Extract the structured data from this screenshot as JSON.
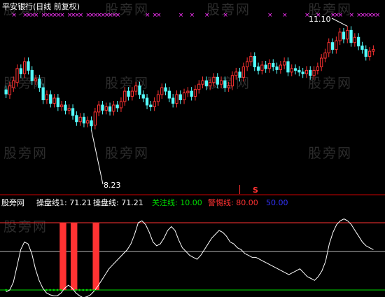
{
  "colors": {
    "background": "#000000",
    "up": "#ff3232",
    "down": "#54ffff",
    "marker": "#ff33ff",
    "divider": "#cc0000",
    "indicator": "#ffffff",
    "focus": "#00dd00",
    "alert": "#ff3232",
    "fifty": "#3333ff",
    "text_white": "#ffffff",
    "text_gray": "#c8c8c8",
    "signal_s": "#ff3232"
  },
  "chart_data": [
    {
      "type": "candlestick",
      "title": "平安银行(日线 前复权)",
      "y_range": [
        6.6,
        11.4
      ],
      "annotations": [
        {
          "text": "11.10",
          "kind": "high",
          "x_index": 92
        },
        {
          "text": "8.23",
          "kind": "low",
          "x_index": 23
        }
      ],
      "signal": {
        "text": "S",
        "x_index": 63
      },
      "markers_x": [
        2,
        5,
        6,
        7,
        8,
        10,
        11,
        12,
        13,
        14,
        15,
        17,
        18,
        19,
        20,
        22,
        23,
        24,
        25,
        26,
        27,
        28,
        29,
        30,
        38,
        40,
        41,
        47,
        50,
        54,
        59,
        71,
        75,
        81,
        84,
        88,
        89,
        90,
        93,
        95,
        96,
        97,
        98,
        99,
        100
      ],
      "candles": [
        {
          "o": 9.34,
          "c": 9.22
        },
        {
          "o": 9.2,
          "c": 9.45
        },
        {
          "o": 9.4,
          "c": 9.6
        },
        {
          "o": 9.55,
          "c": 9.95
        },
        {
          "o": 9.95,
          "c": 9.8
        },
        {
          "o": 9.8,
          "c": 10.15
        },
        {
          "o": 10.15,
          "c": 9.9
        },
        {
          "o": 9.9,
          "c": 9.6
        },
        {
          "o": 9.6,
          "c": 9.65
        },
        {
          "o": 9.65,
          "c": 9.4
        },
        {
          "o": 9.4,
          "c": 9.05
        },
        {
          "o": 9.05,
          "c": 9.2
        },
        {
          "o": 9.2,
          "c": 8.95
        },
        {
          "o": 8.95,
          "c": 9.1
        },
        {
          "o": 9.1,
          "c": 8.85
        },
        {
          "o": 8.85,
          "c": 8.9
        },
        {
          "o": 8.9,
          "c": 8.75
        },
        {
          "o": 8.75,
          "c": 8.8
        },
        {
          "o": 8.8,
          "c": 8.6
        },
        {
          "o": 8.6,
          "c": 8.42
        },
        {
          "o": 8.42,
          "c": 8.55
        },
        {
          "o": 8.55,
          "c": 8.38
        },
        {
          "o": 8.38,
          "c": 8.45
        },
        {
          "o": 8.45,
          "c": 8.3
        },
        {
          "o": 8.32,
          "c": 8.7
        },
        {
          "o": 8.7,
          "c": 8.9
        },
        {
          "o": 8.9,
          "c": 8.75
        },
        {
          "o": 8.75,
          "c": 8.85
        },
        {
          "o": 8.85,
          "c": 8.72
        },
        {
          "o": 8.72,
          "c": 8.9
        },
        {
          "o": 8.9,
          "c": 8.82
        },
        {
          "o": 8.82,
          "c": 9.0
        },
        {
          "o": 9.0,
          "c": 9.3
        },
        {
          "o": 9.3,
          "c": 9.15
        },
        {
          "o": 9.15,
          "c": 9.3
        },
        {
          "o": 9.3,
          "c": 9.45
        },
        {
          "o": 9.45,
          "c": 9.2
        },
        {
          "o": 9.2,
          "c": 9.1
        },
        {
          "o": 9.1,
          "c": 8.9
        },
        {
          "o": 8.9,
          "c": 8.85
        },
        {
          "o": 8.85,
          "c": 9.0
        },
        {
          "o": 9.0,
          "c": 9.2
        },
        {
          "o": 9.2,
          "c": 9.4
        },
        {
          "o": 9.4,
          "c": 9.3
        },
        {
          "o": 9.3,
          "c": 9.1
        },
        {
          "o": 9.1,
          "c": 8.95
        },
        {
          "o": 8.95,
          "c": 9.2
        },
        {
          "o": 9.2,
          "c": 9.05
        },
        {
          "o": 9.05,
          "c": 9.25
        },
        {
          "o": 9.25,
          "c": 9.3
        },
        {
          "o": 9.3,
          "c": 9.15
        },
        {
          "o": 9.15,
          "c": 9.35
        },
        {
          "o": 9.35,
          "c": 9.5
        },
        {
          "o": 9.5,
          "c": 9.6
        },
        {
          "o": 9.6,
          "c": 9.45
        },
        {
          "o": 9.45,
          "c": 9.55
        },
        {
          "o": 9.55,
          "c": 9.7
        },
        {
          "o": 9.7,
          "c": 9.5
        },
        {
          "o": 9.5,
          "c": 9.6
        },
        {
          "o": 9.6,
          "c": 9.4
        },
        {
          "o": 9.4,
          "c": 9.45
        },
        {
          "o": 9.45,
          "c": 9.75
        },
        {
          "o": 9.75,
          "c": 9.85
        },
        {
          "o": 9.85,
          "c": 9.7
        },
        {
          "o": 9.7,
          "c": 10.0
        },
        {
          "o": 10.0,
          "c": 10.15
        },
        {
          "o": 10.15,
          "c": 10.3
        },
        {
          "o": 10.3,
          "c": 10.0
        },
        {
          "o": 10.0,
          "c": 9.9
        },
        {
          "o": 9.9,
          "c": 10.05
        },
        {
          "o": 10.05,
          "c": 9.95
        },
        {
          "o": 9.95,
          "c": 10.1
        },
        {
          "o": 10.1,
          "c": 10.0
        },
        {
          "o": 10.0,
          "c": 9.92
        },
        {
          "o": 9.92,
          "c": 10.05
        },
        {
          "o": 10.05,
          "c": 10.15
        },
        {
          "o": 10.15,
          "c": 9.85
        },
        {
          "o": 9.85,
          "c": 9.95
        },
        {
          "o": 9.95,
          "c": 9.9
        },
        {
          "o": 9.9,
          "c": 9.85
        },
        {
          "o": 9.85,
          "c": 9.8
        },
        {
          "o": 9.8,
          "c": 9.9
        },
        {
          "o": 9.9,
          "c": 9.75
        },
        {
          "o": 9.75,
          "c": 9.9
        },
        {
          "o": 9.9,
          "c": 10.0
        },
        {
          "o": 10.0,
          "c": 10.25
        },
        {
          "o": 10.25,
          "c": 10.4
        },
        {
          "o": 10.4,
          "c": 10.7
        },
        {
          "o": 10.7,
          "c": 10.5
        },
        {
          "o": 10.5,
          "c": 10.75
        },
        {
          "o": 10.75,
          "c": 11.0
        },
        {
          "o": 11.0,
          "c": 10.8
        },
        {
          "o": 10.8,
          "c": 11.05
        },
        {
          "o": 11.05,
          "c": 10.7
        },
        {
          "o": 10.7,
          "c": 10.85
        },
        {
          "o": 10.85,
          "c": 10.6
        },
        {
          "o": 10.6,
          "c": 10.5
        },
        {
          "o": 10.5,
          "c": 10.3
        },
        {
          "o": 10.3,
          "c": 10.45
        },
        {
          "o": 10.45,
          "c": 10.5
        }
      ]
    },
    {
      "type": "line",
      "name": "操盘线1",
      "value_label": "71.21",
      "y_range": [
        0,
        100
      ],
      "reference_lines": [
        {
          "name": "关注线",
          "value": 10,
          "value_label": "10.00"
        },
        {
          "name": "警惕线",
          "value": 80,
          "value_label": "80.00"
        },
        {
          "name": "fifty",
          "value": 50,
          "value_label": "50.00"
        }
      ],
      "values": [
        8,
        10,
        18,
        35,
        52,
        60,
        58,
        48,
        32,
        20,
        12,
        7,
        5,
        4,
        4,
        7,
        12,
        15,
        12,
        7,
        4,
        2,
        3,
        5,
        9,
        14,
        20,
        26,
        32,
        36,
        40,
        44,
        48,
        52,
        58,
        68,
        80,
        82,
        78,
        70,
        60,
        56,
        58,
        64,
        72,
        76,
        72,
        62,
        54,
        50,
        46,
        44,
        42,
        46,
        52,
        58,
        64,
        68,
        72,
        70,
        66,
        60,
        58,
        54,
        52,
        48,
        46,
        44,
        44,
        42,
        40,
        38,
        36,
        34,
        32,
        30,
        28,
        26,
        28,
        30,
        32,
        28,
        24,
        22,
        20,
        24,
        30,
        40,
        58,
        70,
        78,
        82,
        84,
        82,
        78,
        72,
        66,
        60,
        56,
        54,
        52
      ],
      "signal_bars": [
        {
          "start": 15,
          "end": 16
        },
        {
          "start": 18,
          "end": 19
        },
        {
          "start": 24,
          "end": 25
        }
      ],
      "legend": [
        {
          "text": "股旁网",
          "color_key": "text_white"
        },
        {
          "text": "操盘线1: 71.21",
          "color_key": "text_white"
        },
        {
          "text": "操盘线: 71.21",
          "color_key": "text_white"
        },
        {
          "text": "关注线: 10.00",
          "color_key": "focus"
        },
        {
          "text": "警惕线: 80.00",
          "color_key": "alert"
        },
        {
          "text": "50.00",
          "color_key": "fifty"
        }
      ]
    }
  ],
  "watermarks": [
    "股旁网",
    "股旁网",
    "股旁网",
    "股旁网",
    "股旁网",
    "股旁网",
    "股旁网",
    "股旁网",
    "股旁网",
    "股旁网",
    "股旁网",
    "股旁网"
  ]
}
